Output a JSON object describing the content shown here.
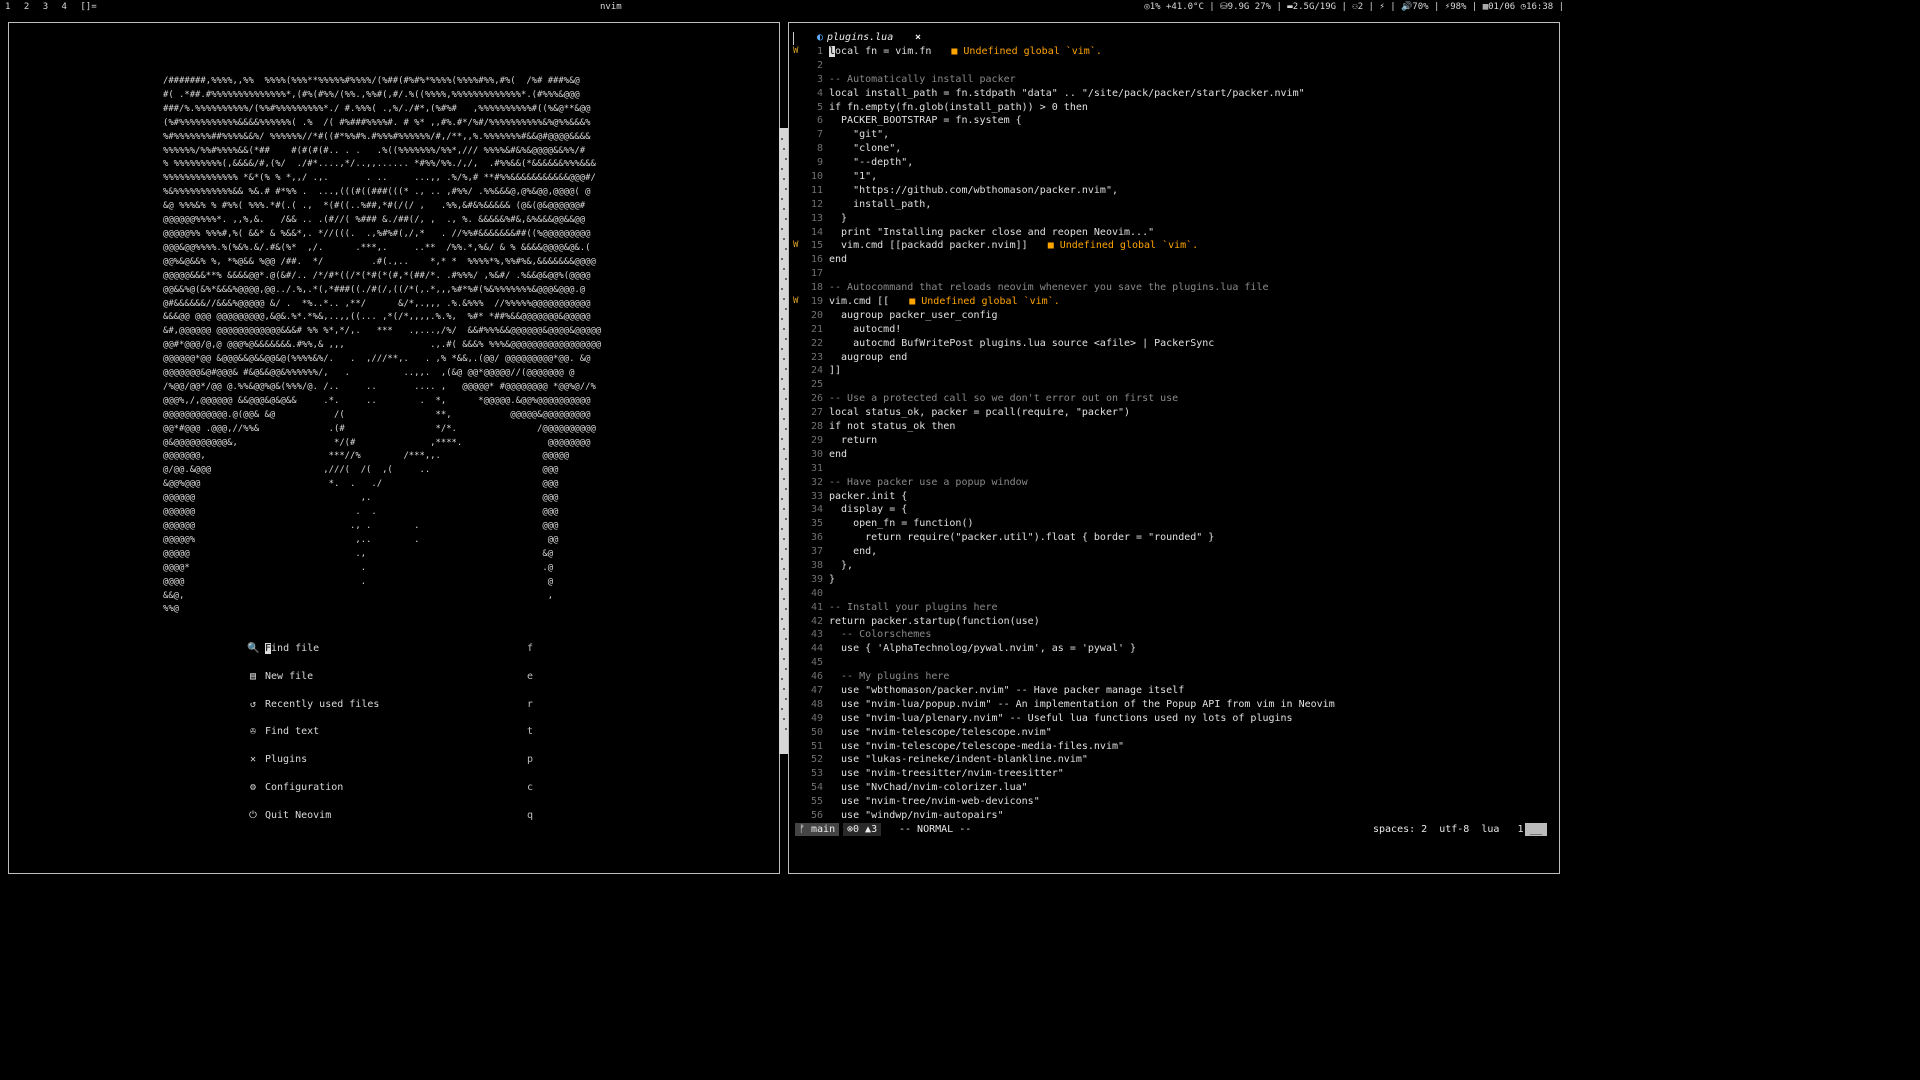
{
  "topbar": {
    "workspaces": [
      "1",
      "2",
      "3",
      "4"
    ],
    "layout": "[]=",
    "window_title": "nvim",
    "status_text": "◎1% +41.0°C | ⛁9.9G 27% | ▬2.5G/19G | ⚇2 | ⚡ | 🔊70% | ⚡98% | ▦01/06 ◷16:38 |"
  },
  "dashboard": {
    "ascii_art": "/#######,%%%%,,%%  %%%%(%%%**%%%%%#%%%%/(%##(#%#%*%%%%(%%%%#%%,#%(  /%# ###%&@\n#( .*##.#%%%%%%%%%%%%%%*,(#%(#%%/(%%.,%%#(,#/.%((%%%%,%%%%%%%%%%%%%*.(#%%%&@@@\n###/%.%%%%%%%%%%/(%%#%%%%%%%%%*./ #.%%%( .,%/./#*,(%#%#   ,%%%%%%%%%%#((%&@**&@@\n(%#%%%%%%%%%%%&&&&%%%%%%( .%  /( #%###%%%%#. # %* ,,#%.#*/%#/%%%%%%%%%%&%@%%&&&%\n%#%%%%%%%##%%%%&&%/ %%%%%%//*#((#*%%#%.#%%%#%%%%%%/#,/**,,%.%%%%%%%#&&@#@@@@&&&&\n%%%%%%/%%#%%%%&&(*##    #(#(#(#.. . .   .%((%%%%%%%/%%*,/// %%%%&#&%&@@@@&&%%/#\n% %%%%%%%%%(,&&&&/#,(%/  ./#*....,*/..,,...... *#%%/%%./,/,  .#%%&&(*&&&&&&%%%&&&\n%%%%%%%%%%%%%% *&*(% % *,,/ .,.       . ..     ...,, .%/%,# **#%%&&&&&&&&&&&@@@#/\n%&%%%%%%%%%%%&& %&.# #*%% .  ...,(((#((###(((* ., .. ,#%%/ .%%&&&@,@%&@@,@@@@( @\n&@ %%%&% % #%%( %%%.*#(.( .,  *(#((..%##,*#(/(/ ,   .%%,&#&%&&&&& (@&(@&@@@@@@#\n@@@@@@%%%%*. ,,%,&.   /&& .. .(#//( %### &./##(/, ,  ., %. &&&&&%#&,&%&&&@@&&@@\n@@@@@%% %%%#,%( &&* & %&&*,. *//(((.  .,%#%#(,/,*   . //%%#&&&&&&&##((%@@@@@@@@@\n@@@&@@%%%%.%(%&%.&/.#&(%*  ,/.      .***,.     ..**  /%%.*,%&/ & % &&&&@@@@&@&.(\n@@%&@&&% %, *%@&& %@@ /##.  */         .#(.,..    *,* *  %%%%*%,%%#%&,&&&&&&&@@@@\n@@@@@&&&**% &&&&@@*.@(&#/.. /*/#*((/*(*#(*(#,*(##/*. .#%%%/ ,%&#/ .%&&@&@@%(@@@@\n@@&&%@(&%*&&&%@@@@,@@../.%,.*(,*###((./#(/,((/*(,.*,,,%#*%#(%&%%%%%%%&@@@&@@@.@\n@#&&&&&&//&&&%@@@@@ &/ .  *%..*.. ,**/      &/*,.,,, .%.&%%%  //%%%%%@@@@@@@@@@@\n&&&@@ @@@ @@@@@@@@@,&@&.%*.*%&,..,,((... ,*(/*,,,,.%.%,  %#* *##%&&@@@@@@@&@@@@@\n&#,@@@@@@ @@@@@@@@@@@@&&&# %% %*,*/,.   ***   .,...,/%/  &&#%%%&&@@@@@@&@@@@&@@@@@\n@@#*@@@/@,@ @@@%@&&&&&&&.#%%,& ,,,                .,.#( &&&% %%%&@@@@@@@@@@@@@@@@@\n@@@@@@*@@ &@@@&&@&&@@&@(%%%%&%/.   .  ,///**,.   . ,% *&&,.(@@/ @@@@@@@@@*@@. &@\n@@@@@@@&@#@@@& #&@&&@@&%%%%%%/,   .          ..,,.  ,(&@ @@*@@@@@//(@@@@@@@ @\n/%@@/@@*/@@ @.%%&@@%@&(%%%/@. /..     ..       .... ,   @@@@@* #@@@@@@@@ *@@%@//%\n@@@%,/,@@@@@@ &&@@@&@&@&&     .*.     ..        .  *,      *@@@@@.&@@%@@@@@@@@@@\n@@@@@@@@@@@@.@(@@& &@           /(                 **,           @@@@@&@@@@@@@@@\n@@*#@@@ .@@@,//%%&             .(#                 */*.               /@@@@@@@@@@\n@&@@@@@@@@@@&,                  */(#              ,****.                @@@@@@@@\n@@@@@@@,                       ***//%        /***,,.                   @@@@@\n@/@@.&@@@                     ,///(  /(  ,(     ..                     @@@\n&@@%@@@                        *.  .   ./                              @@@\n@@@@@@                               ,.                                @@@\n@@@@@@                              .  .                               @@@\n@@@@@@                             ., .        .                       @@@\n@@@@@%                              ,..        .                        @@\n@@@@@                               .,                                 &@\n@@@@*                                .                                 .@\n@@@@                                 .                                  @\n&&@,                                                                    ,\n%%@",
    "menu": [
      {
        "icon": "search-icon",
        "glyph": "🔍",
        "label": "Find file",
        "key": "f"
      },
      {
        "icon": "file-icon",
        "glyph": "▤",
        "label": "New file",
        "key": "e"
      },
      {
        "icon": "history-icon",
        "glyph": "↺",
        "label": "Recently used files",
        "key": "r"
      },
      {
        "icon": "text-search-icon",
        "glyph": "✇",
        "label": "Find text",
        "key": "t"
      },
      {
        "icon": "tools-icon",
        "glyph": "✕",
        "label": "Plugins",
        "key": "p"
      },
      {
        "icon": "gear-icon",
        "glyph": "⚙",
        "label": "Configuration",
        "key": "c"
      },
      {
        "icon": "quit-icon",
        "glyph": "⏻",
        "label": "Quit Neovim",
        "key": "q"
      }
    ]
  },
  "editor": {
    "tab": {
      "name": "plugins.lua",
      "close": "×",
      "icon": "lua-file-icon"
    },
    "diagnostic_message": "Undefined global `vim`.",
    "lines": [
      {
        "n": "1",
        "text": "local fn = vim.fn",
        "sign": "W",
        "diag": "■ Undefined global `vim`."
      },
      {
        "n": "2",
        "text": ""
      },
      {
        "n": "3",
        "text": "-- Automatically install packer",
        "comment": true
      },
      {
        "n": "4",
        "text": "local install_path = fn.stdpath \"data\" .. \"/site/pack/packer/start/packer.nvim\""
      },
      {
        "n": "5",
        "text": "if fn.empty(fn.glob(install_path)) > 0 then"
      },
      {
        "n": "6",
        "text": "  PACKER_BOOTSTRAP = fn.system {"
      },
      {
        "n": "7",
        "text": "    \"git\","
      },
      {
        "n": "8",
        "text": "    \"clone\","
      },
      {
        "n": "9",
        "text": "    \"--depth\","
      },
      {
        "n": "10",
        "text": "    \"1\","
      },
      {
        "n": "11",
        "text": "    \"https://github.com/wbthomason/packer.nvim\","
      },
      {
        "n": "12",
        "text": "    install_path,"
      },
      {
        "n": "13",
        "text": "  }"
      },
      {
        "n": "14",
        "text": "  print \"Installing packer close and reopen Neovim...\""
      },
      {
        "n": "15",
        "text": "  vim.cmd [[packadd packer.nvim]]",
        "sign": "W",
        "diag": "■ Undefined global `vim`."
      },
      {
        "n": "16",
        "text": "end"
      },
      {
        "n": "17",
        "text": ""
      },
      {
        "n": "18",
        "text": "-- Autocommand that reloads neovim whenever you save the plugins.lua file",
        "comment": true
      },
      {
        "n": "19",
        "text": "vim.cmd [[",
        "sign": "W",
        "diag": "■ Undefined global `vim`."
      },
      {
        "n": "20",
        "text": "  augroup packer_user_config"
      },
      {
        "n": "21",
        "text": "    autocmd!"
      },
      {
        "n": "22",
        "text": "    autocmd BufWritePost plugins.lua source <afile> | PackerSync"
      },
      {
        "n": "23",
        "text": "  augroup end"
      },
      {
        "n": "24",
        "text": "]]"
      },
      {
        "n": "25",
        "text": ""
      },
      {
        "n": "26",
        "text": "-- Use a protected call so we don't error out on first use",
        "comment": true
      },
      {
        "n": "27",
        "text": "local status_ok, packer = pcall(require, \"packer\")"
      },
      {
        "n": "28",
        "text": "if not status_ok then"
      },
      {
        "n": "29",
        "text": "  return"
      },
      {
        "n": "30",
        "text": "end"
      },
      {
        "n": "31",
        "text": ""
      },
      {
        "n": "32",
        "text": "-- Have packer use a popup window",
        "comment": true
      },
      {
        "n": "33",
        "text": "packer.init {"
      },
      {
        "n": "34",
        "text": "  display = {"
      },
      {
        "n": "35",
        "text": "    open_fn = function()"
      },
      {
        "n": "36",
        "text": "      return require(\"packer.util\").float { border = \"rounded\" }"
      },
      {
        "n": "37",
        "text": "    end,"
      },
      {
        "n": "38",
        "text": "  },"
      },
      {
        "n": "39",
        "text": "}"
      },
      {
        "n": "40",
        "text": ""
      },
      {
        "n": "41",
        "text": "-- Install your plugins here",
        "comment": true
      },
      {
        "n": "42",
        "text": "return packer.startup(function(use)"
      },
      {
        "n": "43",
        "text": "  -- Colorschemes",
        "comment": true
      },
      {
        "n": "44",
        "text": "  use { 'AlphaTechnolog/pywal.nvim', as = 'pywal' }"
      },
      {
        "n": "45",
        "text": ""
      },
      {
        "n": "46",
        "text": "  -- My plugins here",
        "comment": true
      },
      {
        "n": "47",
        "text": "  use \"wbthomason/packer.nvim\" -- Have packer manage itself"
      },
      {
        "n": "48",
        "text": "  use \"nvim-lua/popup.nvim\" -- An implementation of the Popup API from vim in Neovim"
      },
      {
        "n": "49",
        "text": "  use \"nvim-lua/plenary.nvim\" -- Useful lua functions used ny lots of plugins"
      },
      {
        "n": "50",
        "text": "  use \"nvim-telescope/telescope.nvim\""
      },
      {
        "n": "51",
        "text": "  use \"nvim-telescope/telescope-media-files.nvim\""
      },
      {
        "n": "52",
        "text": "  use \"lukas-reineke/indent-blankline.nvim\""
      },
      {
        "n": "53",
        "text": "  use \"nvim-treesitter/nvim-treesitter\""
      },
      {
        "n": "54",
        "text": "  use \"NvChad/nvim-colorizer.lua\""
      },
      {
        "n": "55",
        "text": "  use \"nvim-tree/nvim-web-devicons\""
      },
      {
        "n": "56",
        "text": "  use \"windwp/nvim-autopairs\""
      }
    ],
    "statusline": {
      "branch": "ᚠ main",
      "diagnostics": "⊗0 ▲3",
      "mode": "-- NORMAL --",
      "right": "spaces: 2  utf-8  lua   1:1",
      "block": "__"
    }
  },
  "colors": {
    "background": "#000000",
    "warning": "#ffa500",
    "comment": "#8a8a8a",
    "accent": "#5fafff"
  }
}
